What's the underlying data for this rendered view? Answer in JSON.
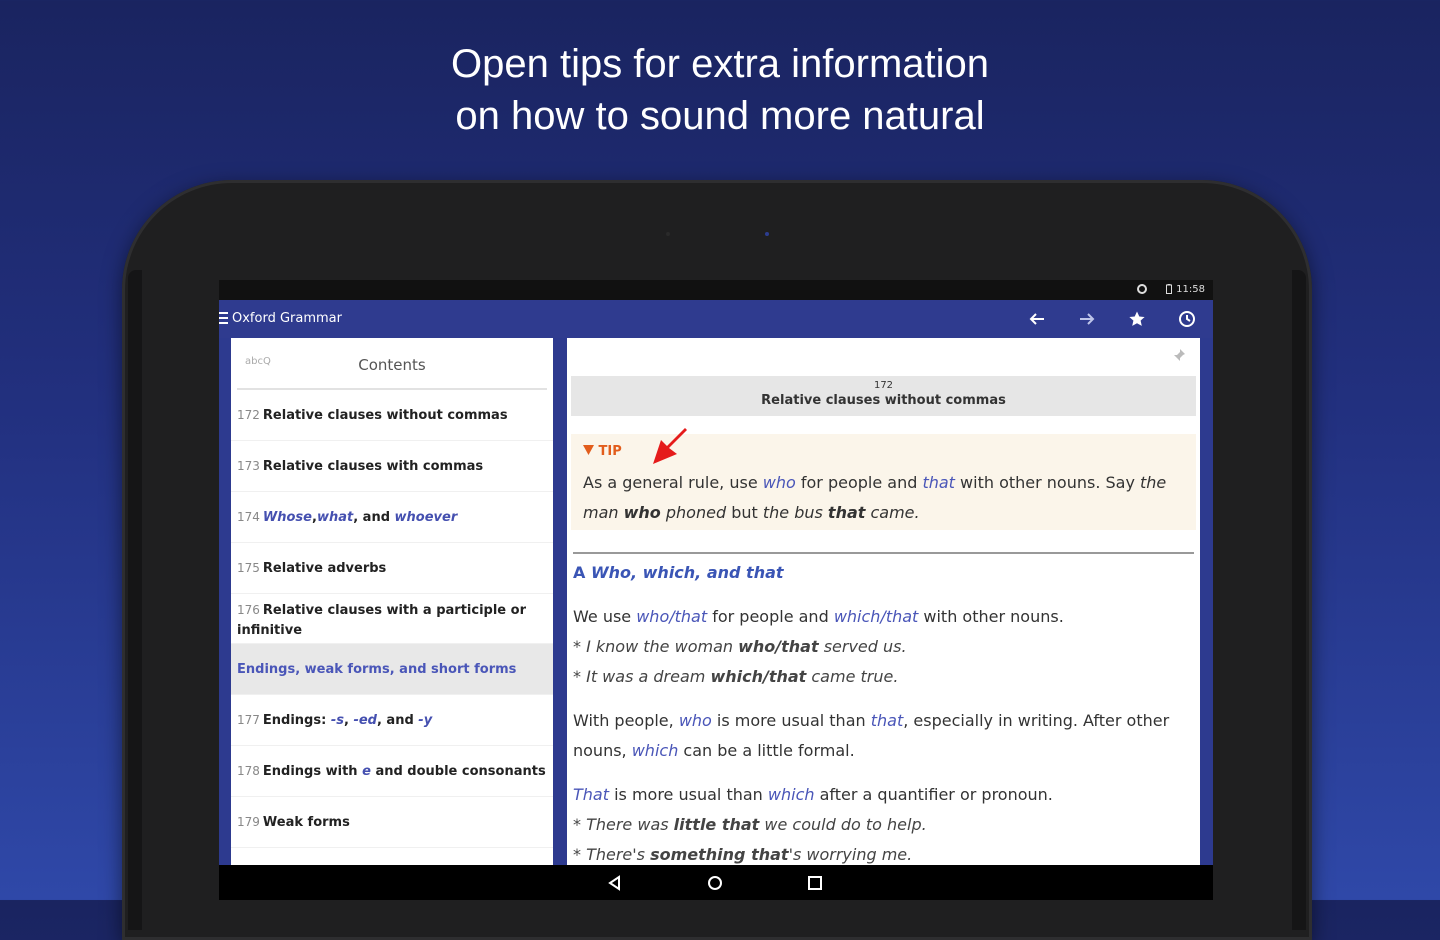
{
  "headline": {
    "line1": "Open tips for extra information",
    "line2": "on how to sound more natural"
  },
  "statusbar": {
    "time": "11:58"
  },
  "appbar": {
    "title": "Oxford Grammar",
    "icons": [
      "back-arrow-icon",
      "forward-arrow-icon",
      "star-icon",
      "history-icon"
    ]
  },
  "sidebar": {
    "search_hint": "abcQ",
    "tab_label": "Contents",
    "items": [
      {
        "num": "172",
        "label": "Relative clauses without commas"
      },
      {
        "num": "173",
        "label": "Relative clauses with commas"
      },
      {
        "num": "174",
        "w1": "Whose",
        "sep1": ", ",
        "w2": "what",
        "sep2": ", and ",
        "w3": "whoever"
      },
      {
        "num": "175",
        "label": "Relative adverbs"
      },
      {
        "num": "176",
        "label": "Relative clauses with a participle or infinitive"
      },
      {
        "label": "Endings, weak forms, and short forms"
      },
      {
        "num": "177",
        "pre": "Endings: ",
        "a": "-s",
        "s1": ", ",
        "b": "-ed",
        "s2": ", and ",
        "c": "-y"
      },
      {
        "num": "178",
        "pre": "Endings with ",
        "e": "e",
        "post": " and double consonants"
      },
      {
        "num": "179",
        "label": "Weak forms"
      }
    ]
  },
  "article": {
    "section_num": "172",
    "section_title": "Relative clauses without commas",
    "tip": {
      "label": "TIP",
      "t1": "As a general rule, use ",
      "who": "who",
      "t2": " for people and ",
      "that": "that",
      "t3": " with other nouns. Say ",
      "ex1": "the man ",
      "ex1b": "who",
      "ex1c": " phoned",
      "t4": " but ",
      "ex2": "the bus ",
      "ex2b": "that",
      "ex2c": " came."
    },
    "heading_letter": "A",
    "heading_text": "Who, which, and that",
    "p1": {
      "t1": "We use ",
      "a": "who/that",
      "t2": " for people and ",
      "b": "which/that",
      "t3": " with other nouns."
    },
    "ex1": {
      "pre": "I know the woman ",
      "b": "who/that",
      "post": " served us."
    },
    "ex2": {
      "pre": "It was a dream ",
      "b": "which/that",
      "post": " came true."
    },
    "p2": {
      "t1": "With people, ",
      "a": "who",
      "t2": " is more usual than ",
      "b": "that",
      "t3": ", especially in writing. After other nouns, ",
      "c": "which",
      "t4": " can be a little formal."
    },
    "p3": {
      "a": "That",
      "t1": " is more usual than ",
      "b": "which",
      "t2": " after a quantifier or pronoun."
    },
    "ex3": {
      "pre": "There was ",
      "b": "little that",
      "post": " we could do to help."
    },
    "ex4": {
      "pre": "There's ",
      "b": "something that",
      "post": "'s worrying me."
    }
  }
}
